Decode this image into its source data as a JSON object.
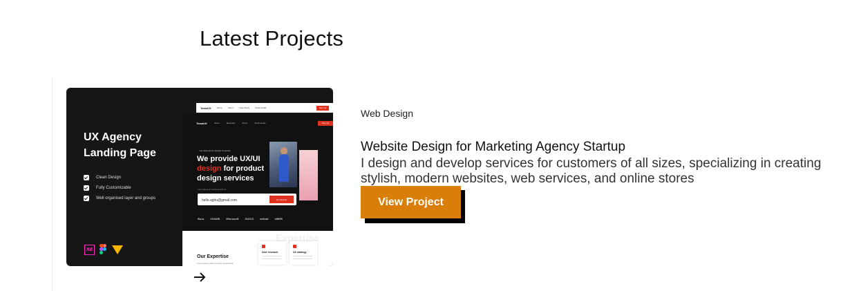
{
  "section": {
    "title": "Latest Projects"
  },
  "thumbnail": {
    "title_line1": "UX Agency",
    "title_line2": "Landing Page",
    "features": [
      "Clean Design",
      "Fully Customizable",
      "Well organised layer and groups"
    ],
    "tools": [
      "xd-icon",
      "figma-icon",
      "sketch-icon"
    ],
    "xd_label": "Xd",
    "mock": {
      "top_logo": "TeamUX",
      "top_links": [
        "Home",
        "About",
        "Case Study",
        "Testimonials"
      ],
      "top_button": "Sign Up",
      "nav_logo": "TeamUX",
      "nav_links": [
        "Home",
        "Expertise",
        "About",
        "Testimonials"
      ],
      "nav_button": "Sign Up",
      "small_label": "Your Experience Design Company",
      "headline_line1": "We provide UX/UI",
      "headline_red": "design",
      "headline_line2_rest": " for product",
      "headline_line3": "design services",
      "form_label": "Let's talk your business with us",
      "input_value": "hello.aghu@gmail.com",
      "submit_label": "Get Started",
      "logos": [
        "Buzz",
        "CHASE",
        "Microsoft",
        "GUCCI",
        "airbnb",
        "UBER"
      ],
      "expertise_title": "Our Expertise",
      "expertise_sub": "Lorem ipsum dolor sit amet consectetur",
      "expertise_watermark": "Expertise",
      "cards": [
        "User research",
        "UX strategy"
      ]
    },
    "colors": {
      "accent_red": "#e0301e",
      "dark_bg": "#161616"
    }
  },
  "project": {
    "category": "Web Design",
    "title": "Website Design for Marketing Agency Startup",
    "description": "I design and develop services for customers of all sizes, specializing in creating stylish, modern websites, web services, and online stores",
    "button_label": "View Project",
    "button_color": "#d97e0a"
  }
}
